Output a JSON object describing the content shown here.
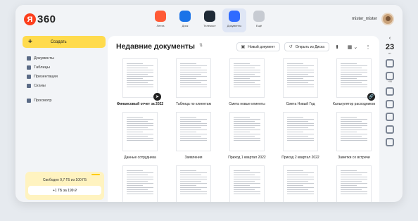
{
  "header": {
    "logo_badge": "Я",
    "logo_text": "360",
    "apps": [
      {
        "label": "Лента",
        "color": "#ff5a36",
        "icon": "feed-icon"
      },
      {
        "label": "Диск",
        "color": "#1a73e8",
        "icon": "disk-icon"
      },
      {
        "label": "Телемост",
        "color": "#1f2a36",
        "icon": "telemost-icon"
      },
      {
        "label": "Документы",
        "color": "#2f6bff",
        "icon": "documents-icon"
      },
      {
        "label": "Ещё",
        "color": "#c7cbd2",
        "icon": "more-icon"
      }
    ],
    "username": "mister_mister"
  },
  "sidebar": {
    "create_label": "Создать",
    "create_plus": "+",
    "items": [
      {
        "label": "Документы",
        "color": "#5b6b86",
        "icon": "document-icon"
      },
      {
        "label": "Таблицы",
        "color": "#5b6b86",
        "icon": "table-icon"
      },
      {
        "label": "Презентации",
        "color": "#5b6b86",
        "icon": "presentation-icon"
      },
      {
        "label": "Сканы",
        "color": "#5b6b86",
        "icon": "scan-icon"
      },
      {
        "label": "Просмотр",
        "color": "#5b6b86",
        "icon": "view-icon"
      }
    ],
    "storage_text": "Свободно 9,7 ГБ из 100 ГБ",
    "storage_button": "+1 ТБ за 199 ₽"
  },
  "main": {
    "title": "Недавние документы",
    "sort_glyph": "⇅",
    "new_doc_label": "Новый документ",
    "new_doc_glyph": "▣",
    "open_disk_label": "Открыть из Диска",
    "open_disk_glyph": "↺",
    "upload_glyph": "⬆",
    "grid_glyph": "▦ ⌄",
    "more_glyph": "⋮",
    "rows": [
      [
        {
          "name": "Финансовый отчет за 2022",
          "bold": true,
          "badge": "➤"
        },
        {
          "name": "Таблица по клиентам",
          "bold": false,
          "badge": ""
        },
        {
          "name": "Смета новые клиенты",
          "bold": false,
          "badge": ""
        },
        {
          "name": "Смета Новый Год",
          "bold": false,
          "badge": ""
        },
        {
          "name": "Калькулятор расходников",
          "bold": false,
          "badge": "🔗"
        }
      ],
      [
        {
          "name": "Данные сотрудника",
          "bold": false,
          "badge": ""
        },
        {
          "name": "Заявления",
          "bold": false,
          "badge": ""
        },
        {
          "name": "Приход 1 квартал 2022",
          "bold": false,
          "badge": ""
        },
        {
          "name": "Приход 2 квартал 2022",
          "bold": false,
          "badge": ""
        },
        {
          "name": "Заметки со встречи",
          "bold": false,
          "badge": ""
        }
      ],
      [
        {
          "name": "",
          "bold": false,
          "badge": ""
        },
        {
          "name": "",
          "bold": false,
          "badge": ""
        },
        {
          "name": "",
          "bold": false,
          "badge": ""
        },
        {
          "name": "",
          "bold": false,
          "badge": ""
        },
        {
          "name": "",
          "bold": false,
          "badge": ""
        }
      ]
    ]
  },
  "rail": {
    "chevron": "‹",
    "day_number": "23",
    "day_label": "пт",
    "mail_caption": "+99",
    "icons": [
      {
        "name": "mail-icon",
        "color": "#7c8594"
      },
      {
        "name": "disk-rail-icon",
        "color": "#7c8594"
      },
      {
        "name": "notes-icon",
        "color": "#7c8594"
      },
      {
        "name": "apps-icon",
        "color": "#7c8594"
      },
      {
        "name": "contacts-icon",
        "color": "#7c8594"
      },
      {
        "name": "tasks-icon",
        "color": "#7c8594"
      },
      {
        "name": "settings-icon",
        "color": "#7c8594"
      }
    ]
  }
}
